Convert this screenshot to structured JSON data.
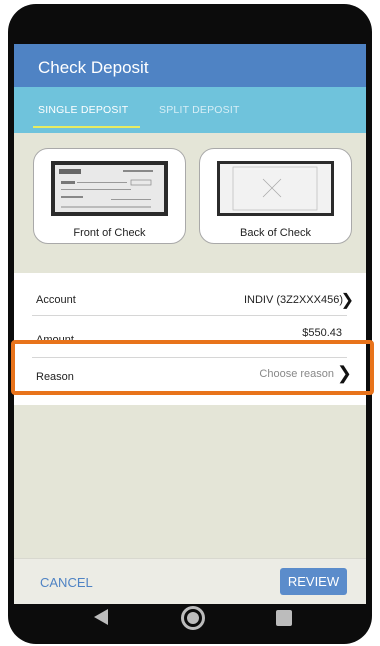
{
  "header": {
    "title": "Check Deposit"
  },
  "tabs": [
    {
      "label": "SINGLE DEPOSIT"
    },
    {
      "label": "SPLIT DEPOSIT"
    }
  ],
  "check_images": {
    "front_label": "Front of Check",
    "back_label": "Back of Check"
  },
  "form": {
    "account": {
      "label": "Account",
      "value": "INDIV (3Z2XXX456)"
    },
    "amount": {
      "label": "Amount",
      "value": "$550.43"
    },
    "reason": {
      "label": "Reason",
      "placeholder": "Choose reason"
    }
  },
  "actions": {
    "cancel_label": "CANCEL",
    "review_label": "REVIEW"
  },
  "colors": {
    "appbar": "#4f83c4",
    "tabbar": "#6fc3dc",
    "tab_indicator": "#e7ec61",
    "highlight": "#e8731b",
    "background": "#e4e5d7"
  },
  "icons": {
    "account_chevron": "chevron-right-icon",
    "reason_chevron": "chevron-right-icon",
    "nav_back": "back-triangle-icon",
    "nav_home": "home-circle-icon",
    "nav_recents": "recents-square-icon"
  }
}
